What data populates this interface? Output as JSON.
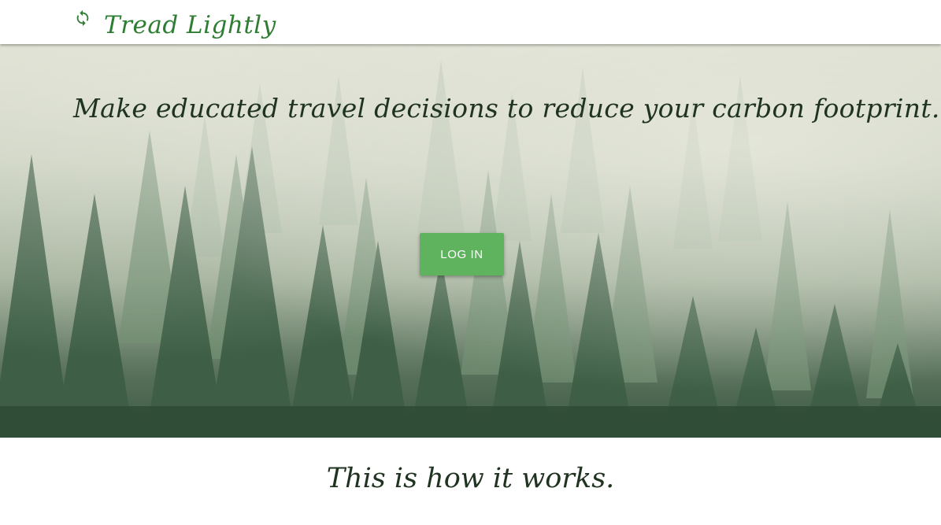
{
  "navbar": {
    "brand_icon": "sync-icon",
    "brand_name": "Tread Lightly",
    "brand_color": "#2e7d32"
  },
  "hero": {
    "tagline": "Make educated travel decisions to reduce your carbon footprint.",
    "login_label": "LOG IN",
    "button_color": "#5fb35f"
  },
  "section": {
    "title": "This is how it works."
  }
}
